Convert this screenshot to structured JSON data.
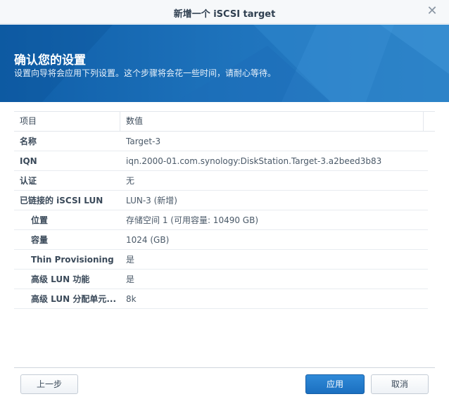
{
  "window": {
    "title": "新增一个 iSCSI target",
    "close_glyph": "✕"
  },
  "banner": {
    "heading": "确认您的设置",
    "subheading": "设置向导将会应用下列设置。这个步骤将会花一些时间，请耐心等待。"
  },
  "grid": {
    "headers": {
      "item": "项目",
      "value": "数值"
    },
    "rows": [
      {
        "key": "名称",
        "value": "Target-3"
      },
      {
        "key": "IQN",
        "value": "iqn.2000-01.com.synology:DiskStation.Target-3.a2beed3b83"
      },
      {
        "key": "认证",
        "value": "无"
      },
      {
        "key": "已链接的 iSCSI LUN",
        "value": "LUN-3 (新增)"
      },
      {
        "key": "位置",
        "value": "存储空间 1 (可用容量: 10490 GB)"
      },
      {
        "key": "容量",
        "value": "1024 (GB)"
      },
      {
        "key": "Thin Provisioning",
        "value": "是"
      },
      {
        "key": "高级 LUN 功能",
        "value": "是"
      },
      {
        "key": "高级 LUN 分配单元...",
        "value": "8k"
      }
    ]
  },
  "footer": {
    "prev_label": "上一步",
    "apply_label": "应用",
    "cancel_label": "取消"
  },
  "colors": {
    "banner_blue": "#1a6bb5",
    "primary_button": "#1f74c4"
  }
}
